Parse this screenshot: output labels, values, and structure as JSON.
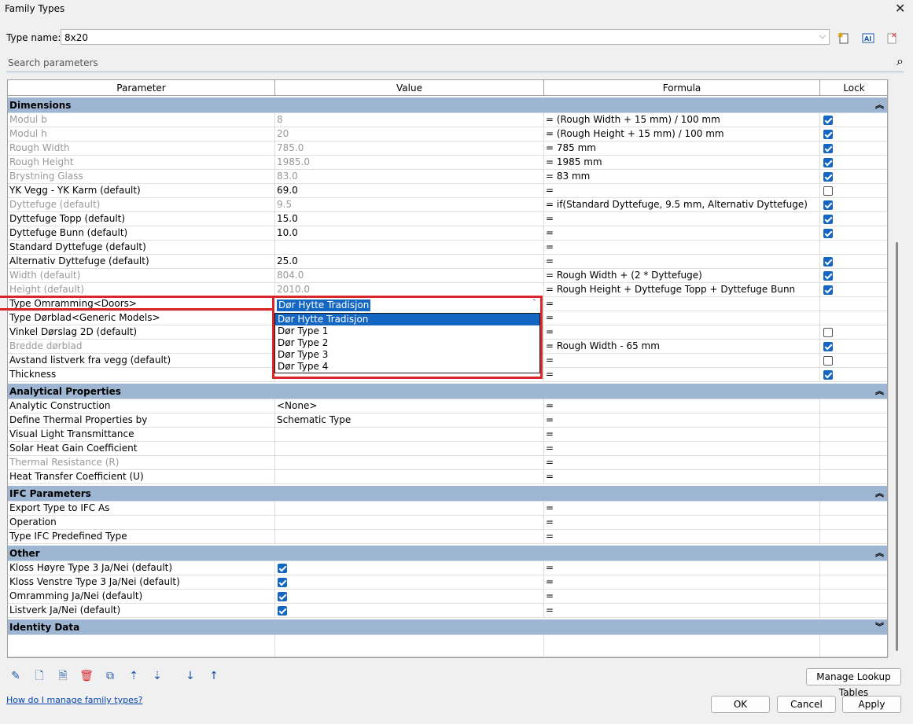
{
  "window": {
    "title": "Family Types"
  },
  "type_name": {
    "label": "Type name:",
    "value": "8x20"
  },
  "search": {
    "placeholder": "Search parameters"
  },
  "columns": [
    "Parameter",
    "Value",
    "Formula",
    "Lock"
  ],
  "sections": {
    "dimensions": "Dimensions",
    "analytical": "Analytical Properties",
    "ifc": "IFC Parameters",
    "other": "Other",
    "identity": "Identity Data"
  },
  "dimensions_rows": [
    {
      "param": "Modul b",
      "value": "8",
      "formula": "= (Rough Width + 15 mm) / 100 mm",
      "lock": "on",
      "grey": true
    },
    {
      "param": "Modul h",
      "value": "20",
      "formula": "= (Rough Height + 15 mm) / 100 mm",
      "lock": "on",
      "grey": true
    },
    {
      "param": "Rough Width",
      "value": "785.0",
      "formula": "= 785 mm",
      "lock": "on",
      "grey": true
    },
    {
      "param": "Rough Height",
      "value": "1985.0",
      "formula": "= 1985 mm",
      "lock": "on",
      "grey": true
    },
    {
      "param": "Brystning Glass",
      "value": "83.0",
      "formula": "= 83 mm",
      "lock": "on",
      "grey": true
    },
    {
      "param": "YK Vegg - YK Karm (default)",
      "value": "69.0",
      "formula": "=",
      "lock": "off",
      "grey": false
    },
    {
      "param": "Dyttefuge (default)",
      "value": "9.5",
      "formula": "= if(Standard Dyttefuge, 9.5 mm, Alternativ Dyttefuge)",
      "lock": "on",
      "grey": true
    },
    {
      "param": "Dyttefuge Topp (default)",
      "value": "15.0",
      "formula": "=",
      "lock": "on",
      "grey": false
    },
    {
      "param": "Dyttefuge Bunn (default)",
      "value": "10.0",
      "formula": "=",
      "lock": "on",
      "grey": false
    },
    {
      "param": "Standard Dyttefuge (default)",
      "value": "",
      "formula": "=",
      "lock": "",
      "grey": false,
      "value_check": "on"
    },
    {
      "param": "Alternativ Dyttefuge (default)",
      "value": "25.0",
      "formula": "=",
      "lock": "on",
      "grey": false
    },
    {
      "param": "Width (default)",
      "value": "804.0",
      "formula": "= Rough Width + (2 * Dyttefuge)",
      "lock": "on",
      "grey": true
    },
    {
      "param": "Height (default)",
      "value": "2010.0",
      "formula": "= Rough Height + Dyttefuge Topp + Dyttefuge Bunn",
      "lock": "on",
      "grey": true
    },
    {
      "param": "Type Omramming<Doors>",
      "value": "",
      "formula": "=",
      "lock": "",
      "grey": false
    },
    {
      "param": "Type Dørblad<Generic Models>",
      "value": "",
      "formula": "=",
      "lock": "",
      "grey": false
    },
    {
      "param": "Vinkel Dørslag 2D (default)",
      "value": "",
      "formula": "=",
      "lock": "off",
      "grey": false
    },
    {
      "param": "Bredde dørblad",
      "value": "",
      "formula": "= Rough Width - 65 mm",
      "lock": "on",
      "grey": true
    },
    {
      "param": "Avstand listverk fra vegg (default)",
      "value": "",
      "formula": "=",
      "lock": "off",
      "grey": false
    },
    {
      "param": "Thickness",
      "value": "",
      "formula": "=",
      "lock": "on",
      "grey": false
    }
  ],
  "dropdown": {
    "selected": "Dør Hytte Tradisjon",
    "options": [
      "Dør Hytte Tradisjon",
      "Dør Type 1",
      "Dør Type 2",
      "Dør Type 3",
      "Dør Type 4"
    ]
  },
  "analytical_rows": [
    {
      "param": "Analytic Construction",
      "value": "<None>",
      "formula": "=",
      "grey": false
    },
    {
      "param": "Define Thermal Properties by",
      "value": "Schematic Type",
      "formula": "=",
      "grey": false
    },
    {
      "param": "Visual Light Transmittance",
      "value": "",
      "formula": "=",
      "grey": false
    },
    {
      "param": "Solar Heat Gain Coefficient",
      "value": "",
      "formula": "=",
      "grey": false
    },
    {
      "param": "Thermal Resistance (R)",
      "value": "",
      "formula": "=",
      "grey": true
    },
    {
      "param": "Heat Transfer Coefficient (U)",
      "value": "",
      "formula": "=",
      "grey": false
    }
  ],
  "ifc_rows": [
    {
      "param": "Export Type to IFC As",
      "formula": "="
    },
    {
      "param": "Operation",
      "formula": "="
    },
    {
      "param": "Type IFC Predefined Type",
      "formula": "="
    }
  ],
  "other_rows": [
    {
      "param": "Kloss Høyre Type 3 Ja/Nei (default)",
      "formula": "="
    },
    {
      "param": "Kloss Venstre Type 3 Ja/Nei (default)",
      "formula": "="
    },
    {
      "param": "Omramming Ja/Nei (default)",
      "formula": "="
    },
    {
      "param": "Listverk Ja/Nei (default)",
      "formula": "="
    }
  ],
  "buttons": {
    "manage_lookup": "Manage Lookup Tables",
    "ok": "OK",
    "cancel": "Cancel",
    "apply": "Apply"
  },
  "help_link": "How do I manage family types?"
}
